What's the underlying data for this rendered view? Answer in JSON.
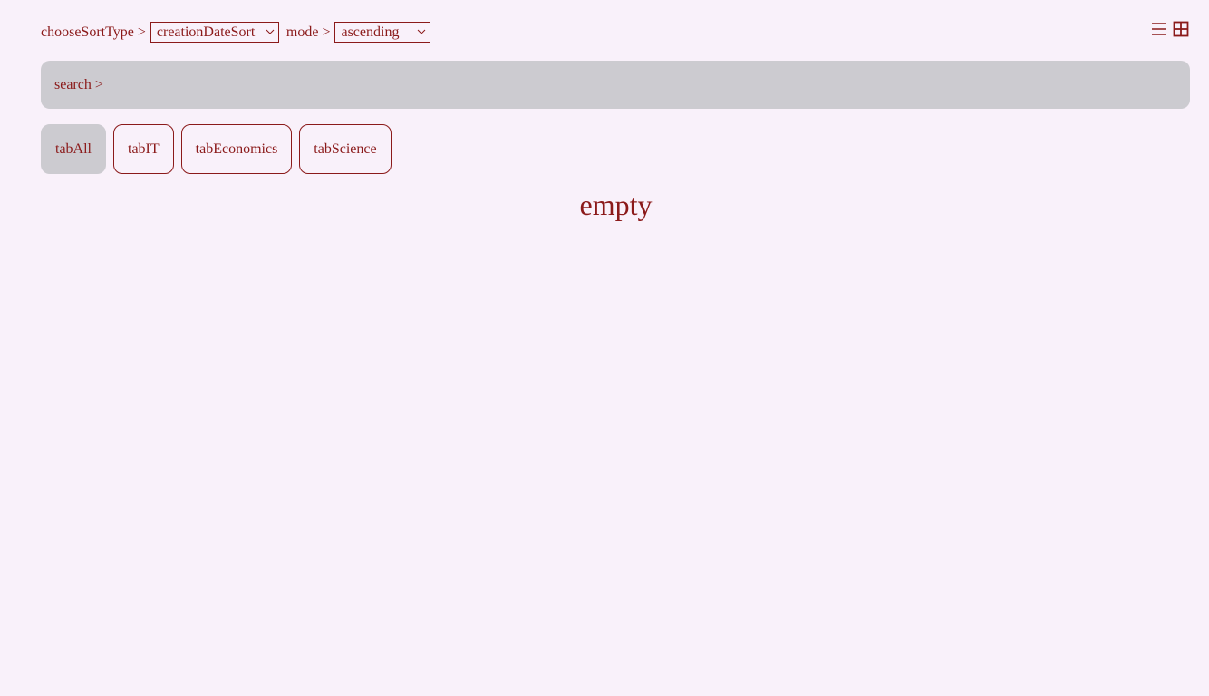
{
  "sort": {
    "type_label": "chooseSortType >",
    "type_value": "creationDateSort",
    "mode_label": "mode >",
    "mode_value": "ascending"
  },
  "view_toggles": {
    "icons": [
      "list-view-icon",
      "grid-view-icon"
    ]
  },
  "search": {
    "label": "search >",
    "value": ""
  },
  "tabs": [
    {
      "label": "tabAll",
      "active": true
    },
    {
      "label": "tabIT",
      "active": false
    },
    {
      "label": "tabEconomics",
      "active": false
    },
    {
      "label": "tabScience",
      "active": false
    }
  ],
  "content": {
    "empty_text": "empty"
  },
  "colors": {
    "background": "#f9f1fa",
    "accent": "#8b1a1a",
    "active_tab": "#cccbd0"
  }
}
